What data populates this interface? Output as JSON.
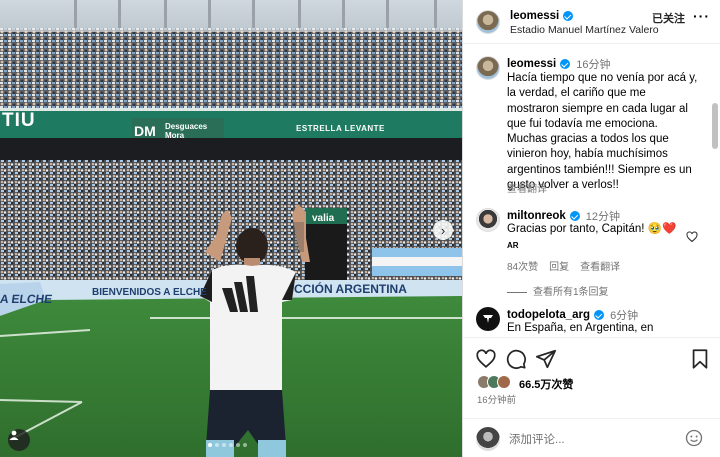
{
  "photo": {
    "signs": {
      "tiu": "TIU",
      "dm": "DM",
      "dm_sub": "Desguaces Mora",
      "estrella": "ESTRELLA LEVANTE",
      "elche": "A ELCHE",
      "bienvenidos": "BIENVENIDOS A ELCHE",
      "seleccion": "CCIÓN ARGENTINA",
      "vallia": "valia"
    },
    "carousel_dots": 6,
    "carousel_active": 0
  },
  "header": {
    "username": "leomessi",
    "location": "Estadio Manuel Martínez Valero",
    "follow_label": "已关注",
    "more_label": "···"
  },
  "caption": {
    "username": "leomessi",
    "time": "16分钟",
    "lines": [
      "Hacía tiempo que no venía por acá y,",
      "la verdad, el cariño que me",
      "mostraron siempre en cada lugar al",
      "que fui todavía me emociona.",
      "Muchas gracias a todos los que",
      "vinieron hoy, había muchísimos",
      "argentinos también!!! Siempre es un",
      "gusto volver a verlos!!"
    ],
    "translate_label": "查看翻译"
  },
  "comments": [
    {
      "username": "miltonreok",
      "time": "12分钟",
      "text": "Gracias por tanto, Capitán! 🥹❤️",
      "sub": "AR",
      "likes": "84次赞",
      "reply_label": "回复",
      "translate_label": "查看翻译",
      "view_replies": "查看所有1条回复"
    },
    {
      "username": "todopelota_arg",
      "time": "6分钟",
      "text": "En España, en Argentina, en"
    }
  ],
  "actions": {
    "likes": "66.5万次赞",
    "post_time": "16分钟前"
  },
  "composer": {
    "placeholder": "添加评论..."
  },
  "colors": {
    "verified": "#0095f6",
    "heart": "#ed4956",
    "muted": "#737373"
  }
}
